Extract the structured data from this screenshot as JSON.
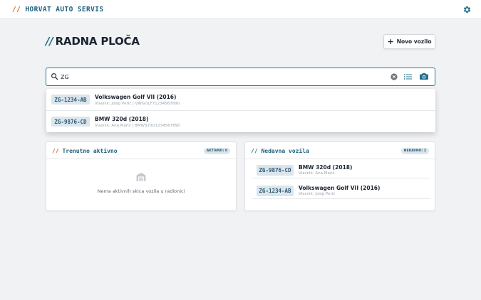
{
  "header": {
    "brand_slash": "//",
    "brand_name": "HORVAT AUTO SERVIS",
    "settings_icon": "gear-icon"
  },
  "page": {
    "title_slash": "//",
    "title": "RADNA PLOČA",
    "new_vehicle_plus": "+",
    "new_vehicle_label": "Novo vozilo"
  },
  "search": {
    "value": "ZG",
    "icons": [
      "search-icon",
      "clear-icon",
      "list-icon",
      "camera-icon"
    ]
  },
  "suggestions": [
    {
      "plate": "ZG-1234-AB",
      "title": "Volkswagen Golf VII (2016)",
      "subtitle": "Vlasnik: Josip Perić | VWGOLF71234567890"
    },
    {
      "plate": "ZG-9876-CD",
      "title": "BMW 320d (2018)",
      "subtitle": "Vlasnik: Ana Marić | BMW320D1234567890"
    }
  ],
  "active_panel": {
    "slash": "//",
    "title": "Trenutno aktivno",
    "badge": "AKTIVNO: 0",
    "empty_text": "Nema aktivnih skica vozila u radionici",
    "empty_icon": "garage-icon"
  },
  "recent_panel": {
    "slash": "//",
    "title": "Nedavna vozila",
    "badge": "NEDAVNO: 2",
    "items": [
      {
        "plate": "ZG-9876-CD",
        "title": "BMW 320d (2018)",
        "subtitle": "Vlasnik: Ana Marić"
      },
      {
        "plate": "ZG-1234-AB",
        "title": "Volkswagen Golf VII (2016)",
        "subtitle": "Vlasnik: Josip Perić"
      }
    ]
  },
  "colors": {
    "accent": "#1f5f7e",
    "slash_orange": "#e05a1e",
    "search_border": "#2c7697",
    "plate_bg": "#dbe5ec",
    "background": "#f1f2f4"
  }
}
